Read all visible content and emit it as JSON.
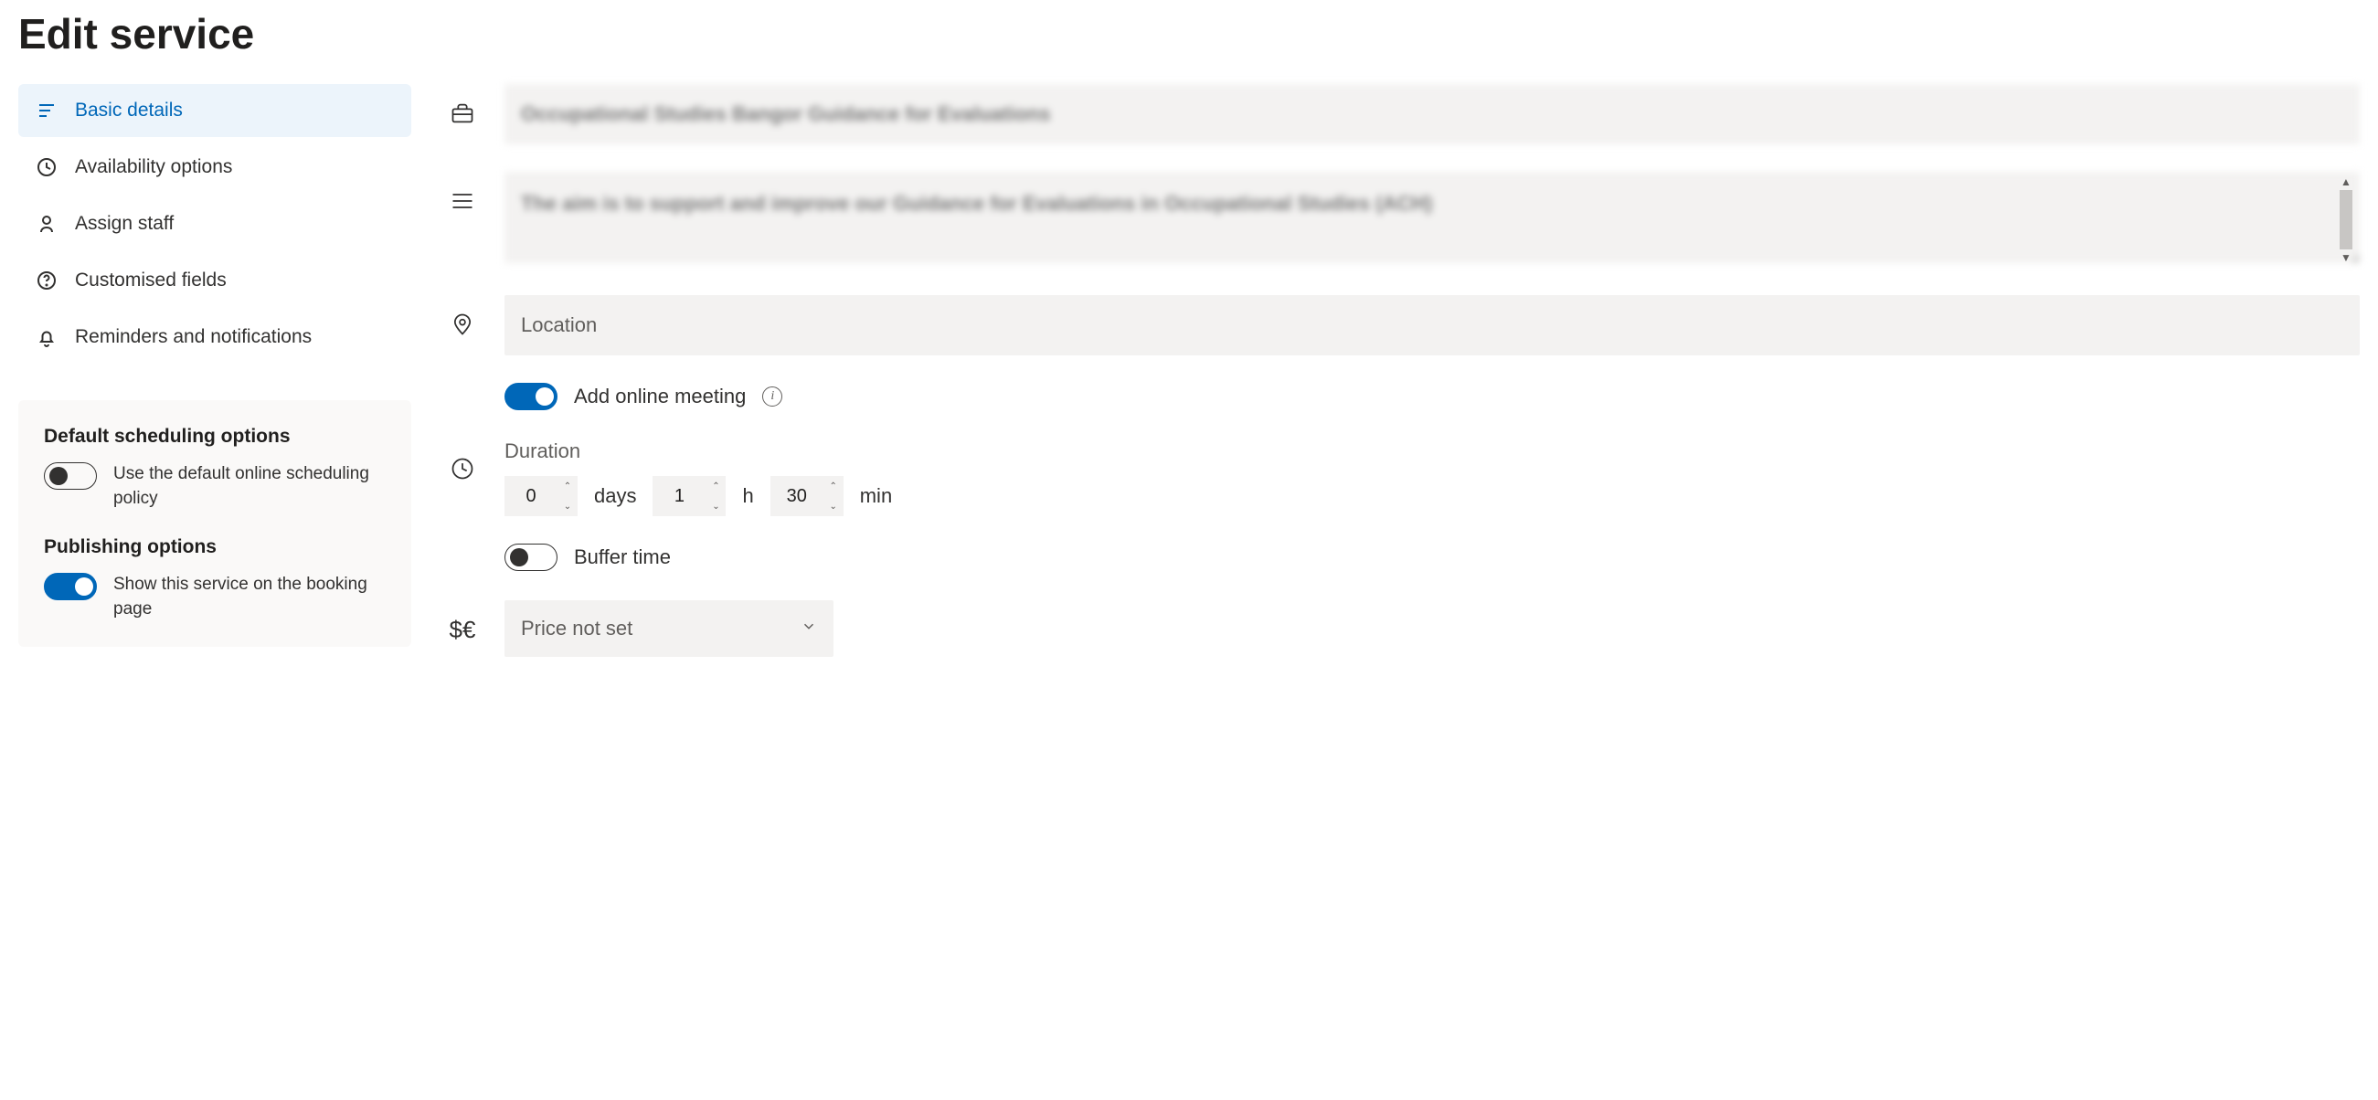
{
  "page": {
    "title": "Edit service"
  },
  "nav": {
    "items": [
      {
        "label": "Basic details"
      },
      {
        "label": "Availability options"
      },
      {
        "label": "Assign staff"
      },
      {
        "label": "Customised fields"
      },
      {
        "label": "Reminders and notifications"
      }
    ]
  },
  "sideOptions": {
    "scheduling": {
      "title": "Default scheduling options",
      "toggleLabel": "Use the default online scheduling policy",
      "toggleOn": false
    },
    "publishing": {
      "title": "Publishing options",
      "toggleLabel": "Show this service on the booking page",
      "toggleOn": true
    }
  },
  "form": {
    "serviceName": "Occupational Studies Bangor Guidance for Evaluations",
    "description": "The aim is to support and improve our Guidance for Evaluations in Occupational Studies (ACH)",
    "locationPlaceholder": "Location",
    "locationValue": "",
    "onlineMeeting": {
      "label": "Add online meeting",
      "on": true
    },
    "duration": {
      "label": "Duration",
      "days": "0",
      "daysUnit": "days",
      "hours": "1",
      "hoursUnit": "h",
      "minutes": "30",
      "minutesUnit": "min"
    },
    "bufferTime": {
      "label": "Buffer time",
      "on": false
    },
    "price": {
      "selected": "Price not set"
    }
  }
}
